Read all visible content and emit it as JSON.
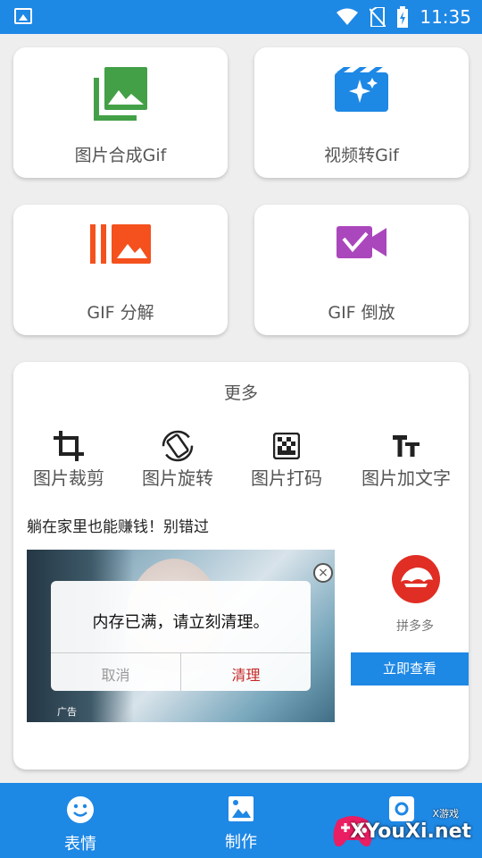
{
  "status_bar": {
    "time": "11:35"
  },
  "tiles": [
    {
      "label": "图片合成Gif",
      "icon": "image-stack-icon",
      "color": "#43a047"
    },
    {
      "label": "视频转Gif",
      "icon": "video-sparkle-icon",
      "color": "#1e88e5"
    },
    {
      "label": "GIF 分解",
      "icon": "gif-split-icon",
      "color": "#f4511e"
    },
    {
      "label": "GIF 倒放",
      "icon": "video-reverse-icon",
      "color": "#ab47bc"
    }
  ],
  "more": {
    "title": "更多",
    "tools": [
      {
        "label": "图片裁剪",
        "icon": "crop-icon"
      },
      {
        "label": "图片旋转",
        "icon": "rotate-icon"
      },
      {
        "label": "图片打码",
        "icon": "mosaic-icon"
      },
      {
        "label": "图片加文字",
        "icon": "text-icon"
      }
    ]
  },
  "ad": {
    "title": "躺在家里也能赚钱！别错过",
    "caption": "广告",
    "dialog_message": "内存已满，请立刻清理。",
    "dialog_cancel": "取消",
    "dialog_confirm": "清理",
    "side_name": "拼多多",
    "side_button": "立即查看"
  },
  "tabbar": {
    "tabs": [
      {
        "label": "表情",
        "icon": "smiley-icon"
      },
      {
        "label": "制作",
        "icon": "image-icon"
      },
      {
        "label": "",
        "icon": "settings-icon"
      }
    ]
  },
  "watermark": {
    "text": "XYouXi.net",
    "sub": "X游戏"
  },
  "colors": {
    "primary": "#1e88e5",
    "danger": "#c62828",
    "pdd": "#e02e24"
  }
}
